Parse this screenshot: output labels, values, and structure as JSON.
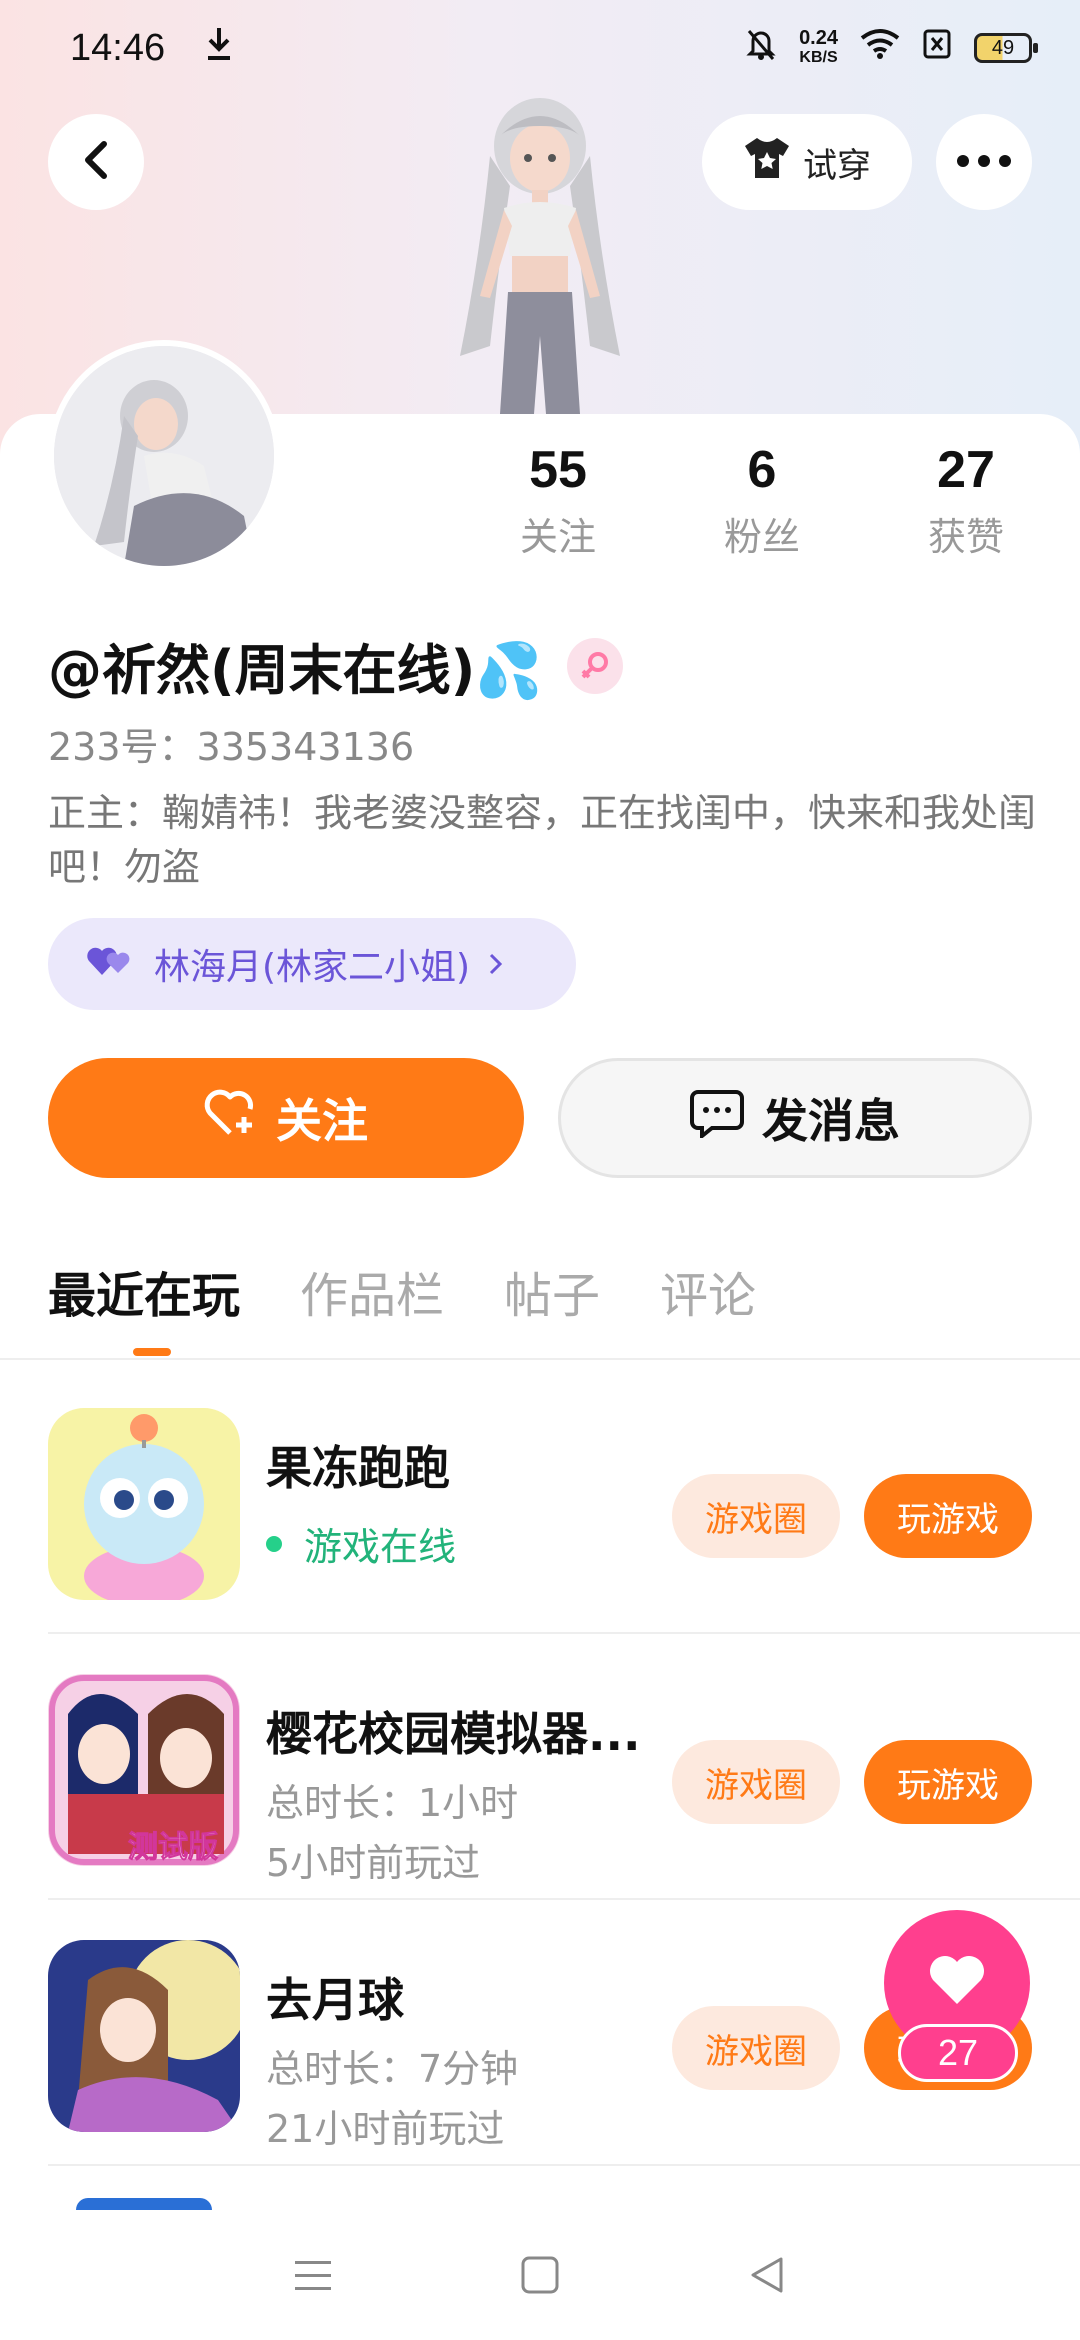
{
  "status_bar": {
    "time": "14:46",
    "net_speed_value": "0.24",
    "net_speed_unit": "KB/S",
    "battery": "49",
    "icons": [
      "download-icon",
      "mute-icon",
      "wifi-icon",
      "sim-off-icon",
      "battery-icon"
    ]
  },
  "header": {
    "try_on_label": "试穿",
    "icons": [
      "back-icon",
      "tshirt-icon",
      "more-icon"
    ]
  },
  "profile": {
    "stats": [
      {
        "value": "55",
        "label": "关注"
      },
      {
        "value": "6",
        "label": "粉丝"
      },
      {
        "value": "27",
        "label": "获赞"
      }
    ],
    "name": "@祈然(周末在线)💦",
    "uid": "233号：335343136",
    "bio": "正主：鞠婧祎！我老婆没整容，正在找闺中，快来和我处闺吧！勿盗",
    "cp_chip": "林海月(林家二小姐)",
    "gender": "female"
  },
  "actions": {
    "follow_label": "关注",
    "message_label": "发消息"
  },
  "tabs": [
    {
      "label": "最近在玩",
      "active": true
    },
    {
      "label": "作品栏",
      "active": false
    },
    {
      "label": "帖子",
      "active": false
    },
    {
      "label": "评论",
      "active": false
    }
  ],
  "games": [
    {
      "title": "果冻跑跑",
      "status": "游戏在线",
      "circle_label": "游戏圈",
      "play_label": "玩游戏"
    },
    {
      "title": "樱花校园模拟器...",
      "duration": "总时长：1小时",
      "last_played": "5小时前玩过",
      "circle_label": "游戏圈",
      "play_label": "玩游戏",
      "icon_badge": "测试版"
    },
    {
      "title": "去月球",
      "duration": "总时长：7分钟",
      "last_played": "21小时前玩过",
      "circle_label": "游戏圈",
      "play_label": "玩游戏"
    }
  ],
  "like_fab": {
    "count": "27"
  },
  "colors": {
    "accent": "#ff7a16",
    "online": "#22b37a",
    "like": "#ff3f8e",
    "chip_bg": "#ebe8fb",
    "chip_text": "#6b55d8"
  }
}
